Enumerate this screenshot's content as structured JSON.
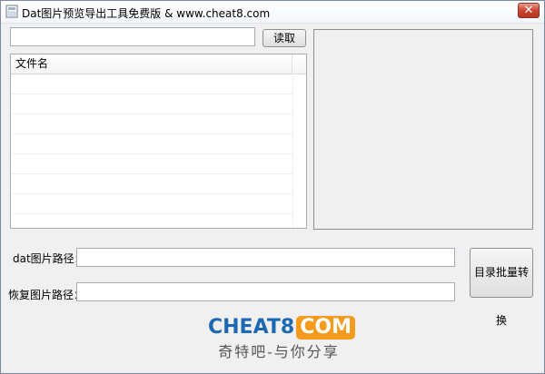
{
  "window": {
    "title": "Dat图片预览导出工具免费版 & www.cheat8.com",
    "close_label": "✕"
  },
  "top": {
    "path_value": "",
    "read_button": "读取"
  },
  "file_list": {
    "column_header": "文件名",
    "rows": []
  },
  "form": {
    "dat_path_label": "dat图片路径：",
    "dat_path_value": "",
    "restore_path_label": "恢复图片路径：",
    "restore_path_value": "",
    "convert_button": "目录批量转换"
  },
  "logo": {
    "main_left": "CHEAT8",
    "main_right": "COM",
    "subtitle": "奇特吧-与你分享"
  },
  "colors": {
    "brand_blue": "#1c68b2",
    "brand_orange": "#f49a1c",
    "close_red": "#c8452e"
  }
}
